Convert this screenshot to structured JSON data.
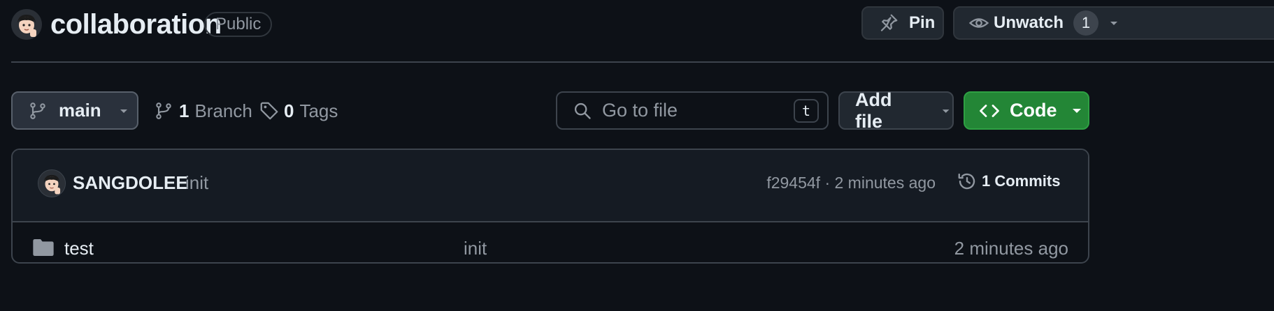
{
  "repo": {
    "name": "collaboration",
    "visibility": "Public",
    "owner_avatar_icon": "avatar-memoji-icon"
  },
  "header_actions": {
    "pin_label": "Pin",
    "watch_label": "Unwatch",
    "watch_count": "1"
  },
  "toolbar": {
    "branch_name": "main",
    "branches_count": "1",
    "branches_label": "Branch",
    "tags_count": "0",
    "tags_label": "Tags",
    "search_placeholder": "Go to file",
    "search_shortcut": "t",
    "add_file_label": "Add file",
    "code_label": "Code"
  },
  "latest_commit": {
    "author": "SANGDOLEE",
    "message": "init",
    "hash_and_time": "f29454f · 2 minutes ago",
    "commits_label": "1 Commits"
  },
  "files": [
    {
      "name": "test",
      "type": "folder",
      "icon": "folder-icon",
      "message": "init",
      "time": "2 minutes ago"
    }
  ],
  "colors": {
    "background": "#0d1117",
    "border": "#3d444d",
    "muted_text": "#9198a1",
    "code_button_green": "#238636",
    "folder_icon": "#9198a1"
  }
}
